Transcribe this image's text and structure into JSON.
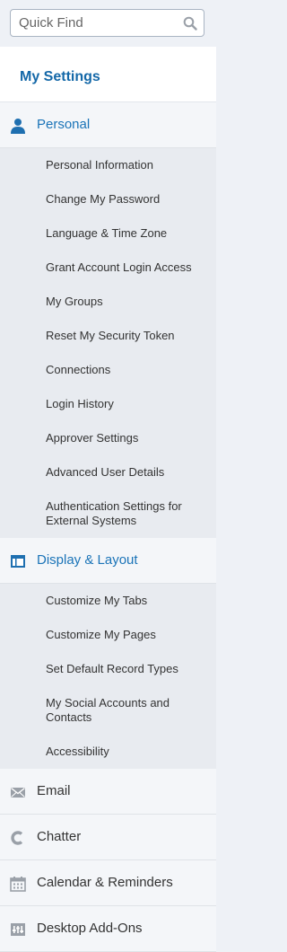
{
  "search": {
    "placeholder": "Quick Find",
    "value": ""
  },
  "page_title": "My Settings",
  "sections": [
    {
      "label": "Personal",
      "icon": "person-icon",
      "expanded": true,
      "items": [
        "Personal Information",
        "Change My Password",
        "Language & Time Zone",
        "Grant Account Login Access",
        "My Groups",
        "Reset My Security Token",
        "Connections",
        "Login History",
        "Approver Settings",
        "Advanced User Details",
        "Authentication Settings for External Systems"
      ]
    },
    {
      "label": "Display & Layout",
      "icon": "layout-icon",
      "expanded": true,
      "items": [
        "Customize My Tabs",
        "Customize My Pages",
        "Set Default Record Types",
        "My Social Accounts and Contacts",
        "Accessibility"
      ]
    },
    {
      "label": "Email",
      "icon": "envelope-icon",
      "expanded": false,
      "items": []
    },
    {
      "label": "Chatter",
      "icon": "chatter-icon",
      "expanded": false,
      "items": []
    },
    {
      "label": "Calendar & Reminders",
      "icon": "calendar-icon",
      "expanded": false,
      "items": []
    },
    {
      "label": "Desktop Add-Ons",
      "icon": "desktop-addons-icon",
      "expanded": false,
      "items": []
    }
  ],
  "colors": {
    "accent": "#1b74b8",
    "title": "#1468a8",
    "icon_blue": "#1e6fb0",
    "icon_gray": "#9aa0a8"
  }
}
